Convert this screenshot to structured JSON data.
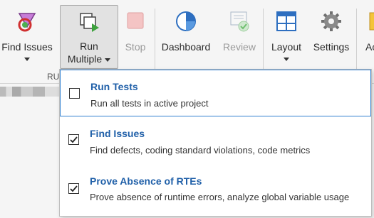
{
  "toolbar": {
    "find_issues": "Find Issues",
    "run_multiple_line1": "Run",
    "run_multiple_line2": "Multiple",
    "stop": "Stop",
    "dashboard": "Dashboard",
    "review": "Review",
    "layout": "Layout",
    "settings": "Settings",
    "cut_off": "Ac",
    "section_label": "RU"
  },
  "menu": {
    "items": [
      {
        "title": "Run Tests",
        "description": "Run all tests in active project",
        "checked": false
      },
      {
        "title": "Find Issues",
        "description": "Find defects, coding standard violations, code metrics",
        "checked": true
      },
      {
        "title": "Prove Absence of RTEs",
        "description": "Prove absence of runtime errors, analyze global variable usage",
        "checked": true
      }
    ]
  },
  "colors": {
    "accent_text": "#1f5fa8",
    "selection_border": "#2f7fd0",
    "disabled_text": "#9a9a9a"
  }
}
